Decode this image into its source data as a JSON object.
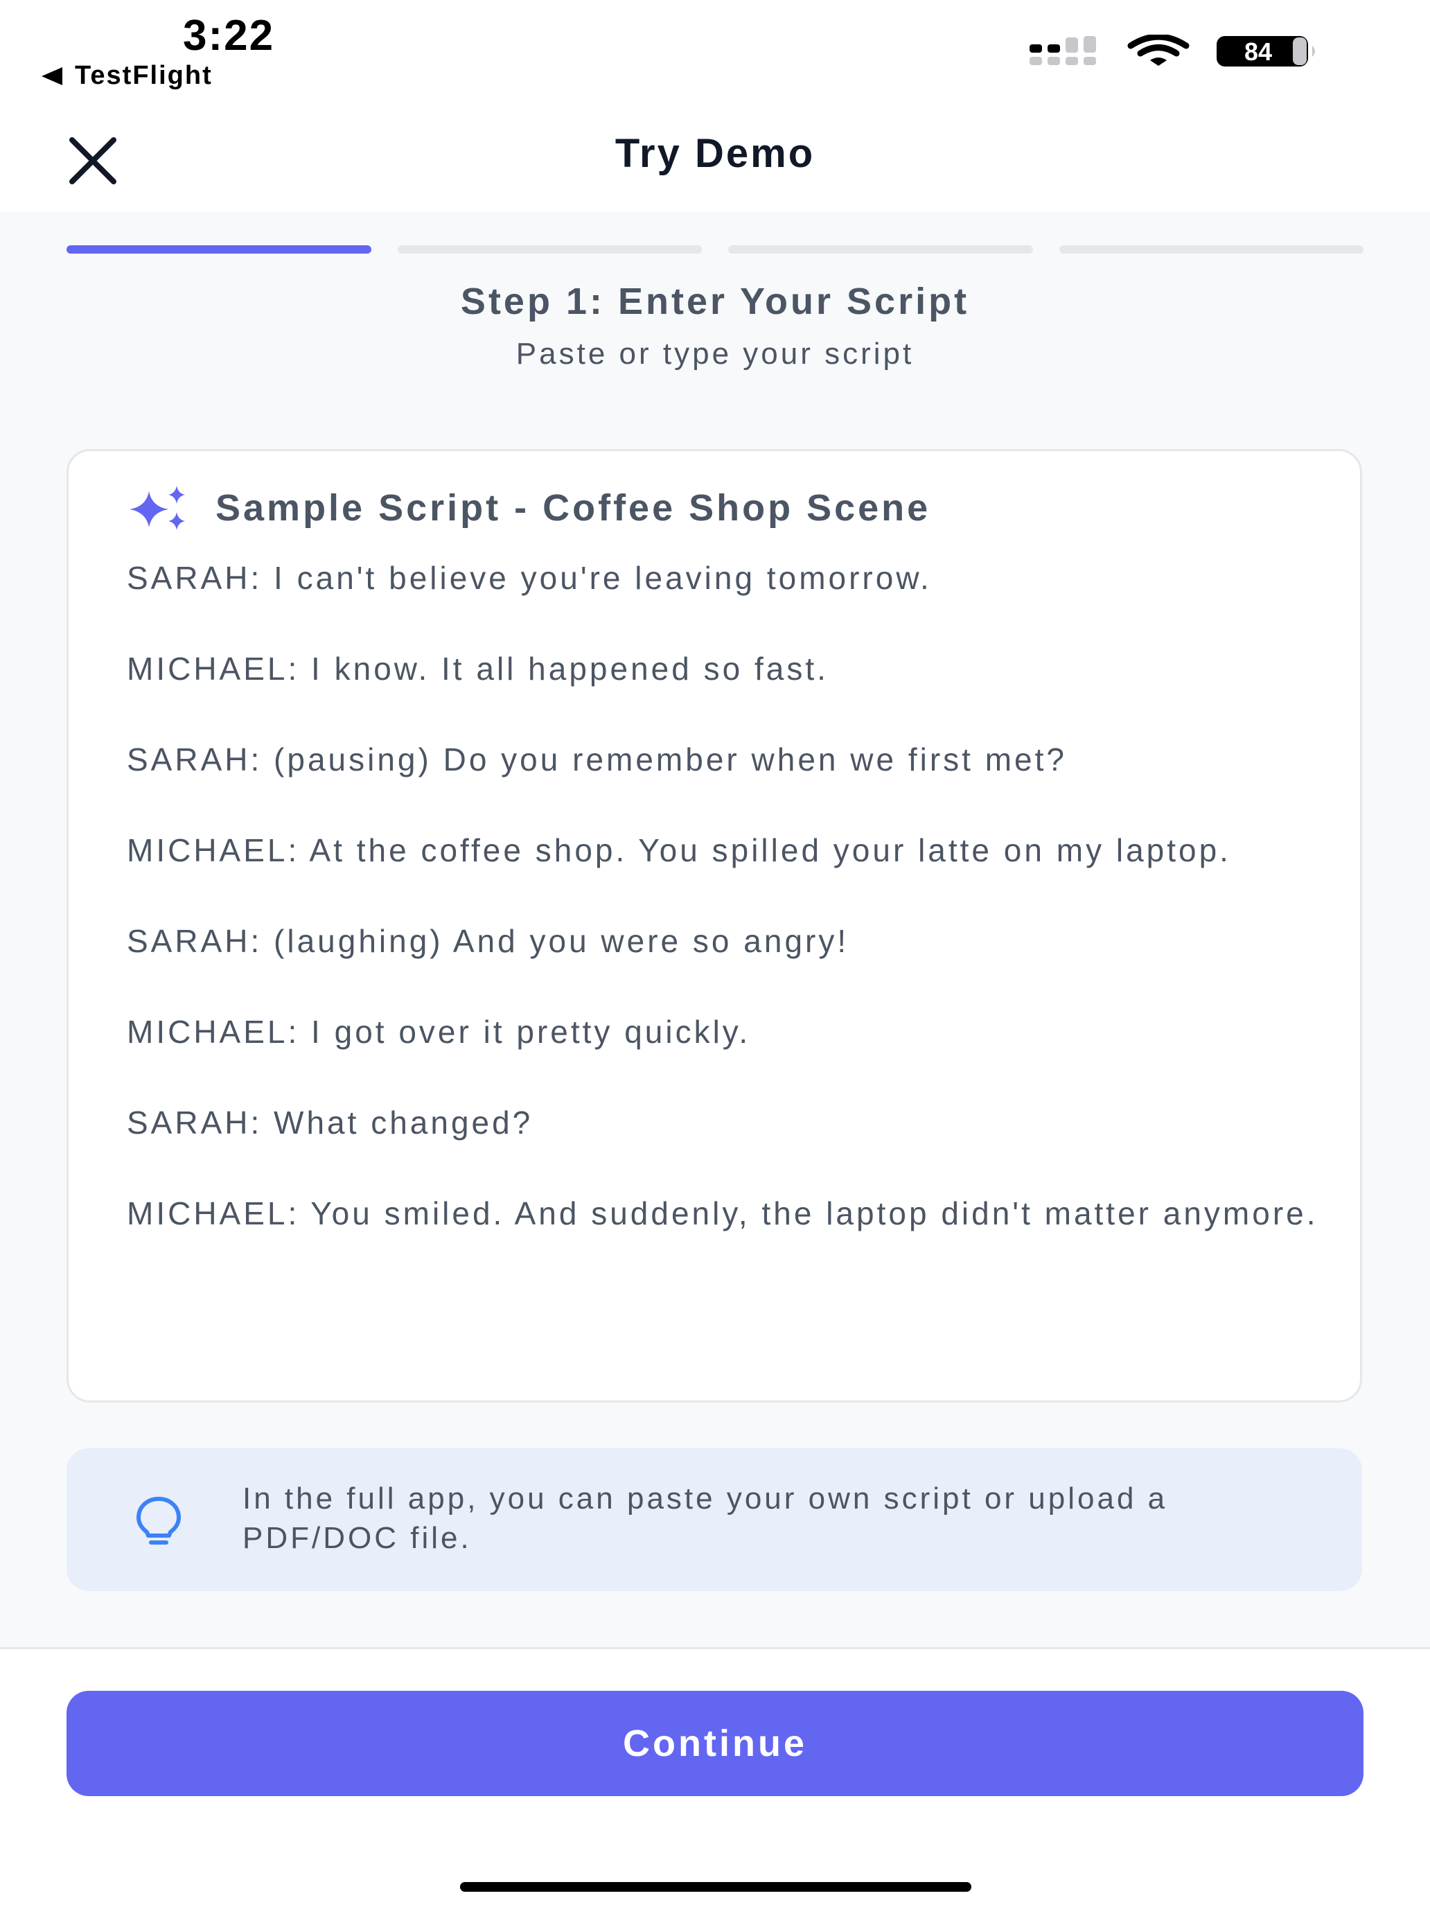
{
  "status_bar": {
    "time": "3:22",
    "back_app": "TestFlight",
    "battery_level": "84",
    "icons": [
      "signal-icon",
      "wifi-icon",
      "battery-icon"
    ]
  },
  "nav": {
    "title": "Try Demo",
    "close_icon": "close-icon"
  },
  "progress": {
    "total_steps": 4,
    "current_step": 1
  },
  "step": {
    "title": "Step 1: Enter Your Script",
    "subtitle": "Paste or type your script"
  },
  "script_card": {
    "icon": "sparkles-icon",
    "title": "Sample Script - Coffee Shop Scene",
    "lines": [
      "SARAH: I can't believe you're leaving tomorrow.",
      "MICHAEL: I know. It all happened so fast.",
      "SARAH: (pausing) Do you remember when we first met?",
      "MICHAEL: At the coffee shop. You spilled your latte on my laptop.",
      "SARAH: (laughing) And you were so angry!",
      "MICHAEL: I got over it pretty quickly.",
      "SARAH: What changed?",
      "MICHAEL: You smiled. And suddenly, the laptop didn't matter anymore."
    ]
  },
  "tip": {
    "icon": "lightbulb-icon",
    "text": "In the full app, you can paste your own script or upload a PDF/DOC file."
  },
  "footer": {
    "continue_label": "Continue"
  },
  "colors": {
    "accent": "#6366f1",
    "tip_background": "#e8eefa",
    "tip_icon": "#3b82f6",
    "body_text": "#4b5563"
  }
}
